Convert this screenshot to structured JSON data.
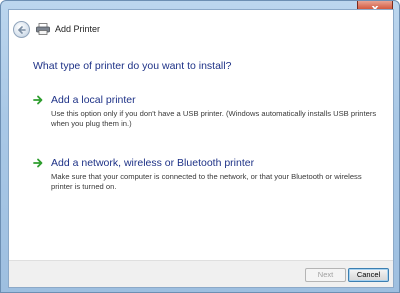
{
  "window": {
    "title": "Add Printer",
    "close_label": "x"
  },
  "main": {
    "heading": "What type of printer do you want to install?",
    "options": [
      {
        "title": "Add a local printer",
        "description": "Use this option only if you don't have a USB printer. (Windows automatically installs USB printers when you plug them in.)"
      },
      {
        "title": "Add a network, wireless or Bluetooth printer",
        "description": "Make sure that your computer is connected to the network, or that your Bluetooth or wireless printer is turned on."
      }
    ]
  },
  "footer": {
    "next_label": "Next",
    "cancel_label": "Cancel"
  },
  "icons": {
    "back": "back-arrow-icon",
    "printer": "printer-icon",
    "option_arrow": "green-arrow-icon"
  },
  "colors": {
    "heading": "#1e3287",
    "option_arrow": "#2e9e2e",
    "close_button": "#c0392b"
  }
}
